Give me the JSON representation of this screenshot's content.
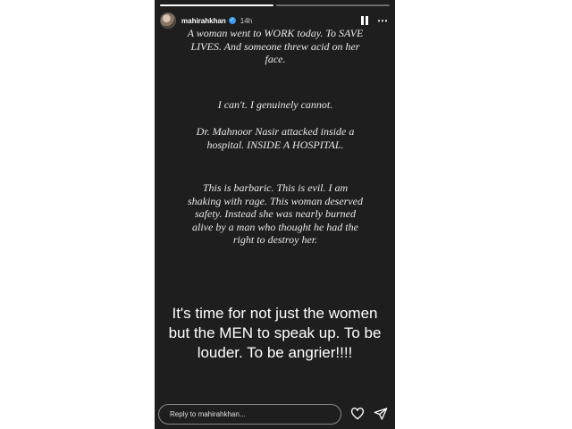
{
  "header": {
    "username": "mahirahkhan",
    "time": "14h"
  },
  "story": {
    "paragraphs": [
      "A woman went to WORK today. To SAVE LIVES. And someone threw acid on her face.",
      "I can't. I genuinely cannot.",
      "Dr. Mahnoor Nasir attacked inside a hospital. INSIDE A HOSPITAL.",
      "This is barbaric. This is evil. I am shaking with rage. This woman deserved safety. Instead she was nearly burned alive by a man who thought he had the right to destroy her."
    ],
    "statement": "It's time for not just the women but the MEN to speak up. To be louder. To be angrier!!!!"
  },
  "footer": {
    "reply_placeholder": "Reply to mahirahkhan..."
  },
  "icons": {
    "verified": "verified-badge-icon",
    "pause": "pause-icon",
    "more": "more-options-icon",
    "like": "heart-icon",
    "share": "send-icon"
  },
  "colors": {
    "story_background": "#1e1e1e",
    "text": "#ffffff",
    "verified": "#3897f0"
  }
}
